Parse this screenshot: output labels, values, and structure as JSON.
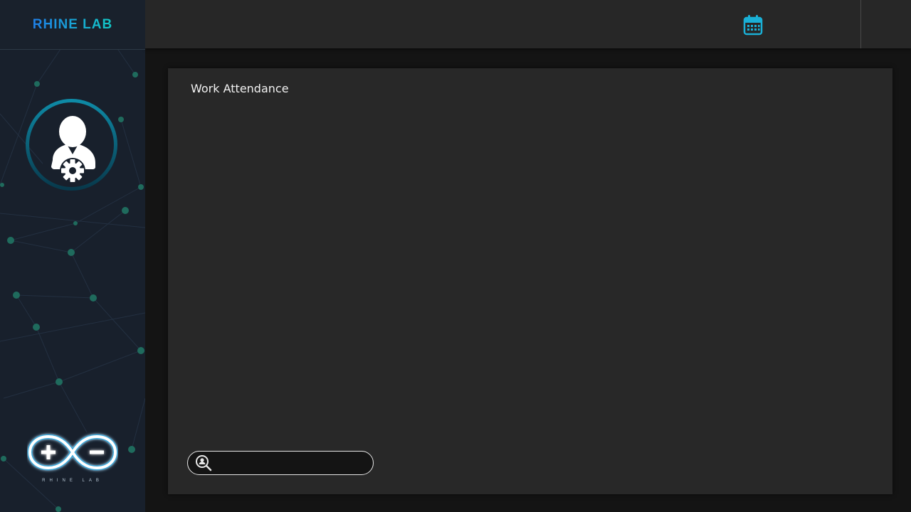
{
  "app": {
    "brand": "RHINE LAB",
    "logo_caption": "RHINE LAB"
  },
  "header": {
    "calendar_icon": "calendar-icon"
  },
  "sidebar": {
    "avatar_icon": "user-settings-icon",
    "logo_icon": "infinity-plus-minus-logo"
  },
  "main": {
    "panel_title": "Work Attendance"
  },
  "search": {
    "value": "",
    "placeholder": "",
    "icon": "user-search-icon"
  },
  "colors": {
    "accent": "#1ab0d6",
    "brand_start": "#1f7fe6",
    "brand_end": "#12c7c4",
    "sidebar_bg": "#18202c",
    "panel_bg": "#282828"
  }
}
